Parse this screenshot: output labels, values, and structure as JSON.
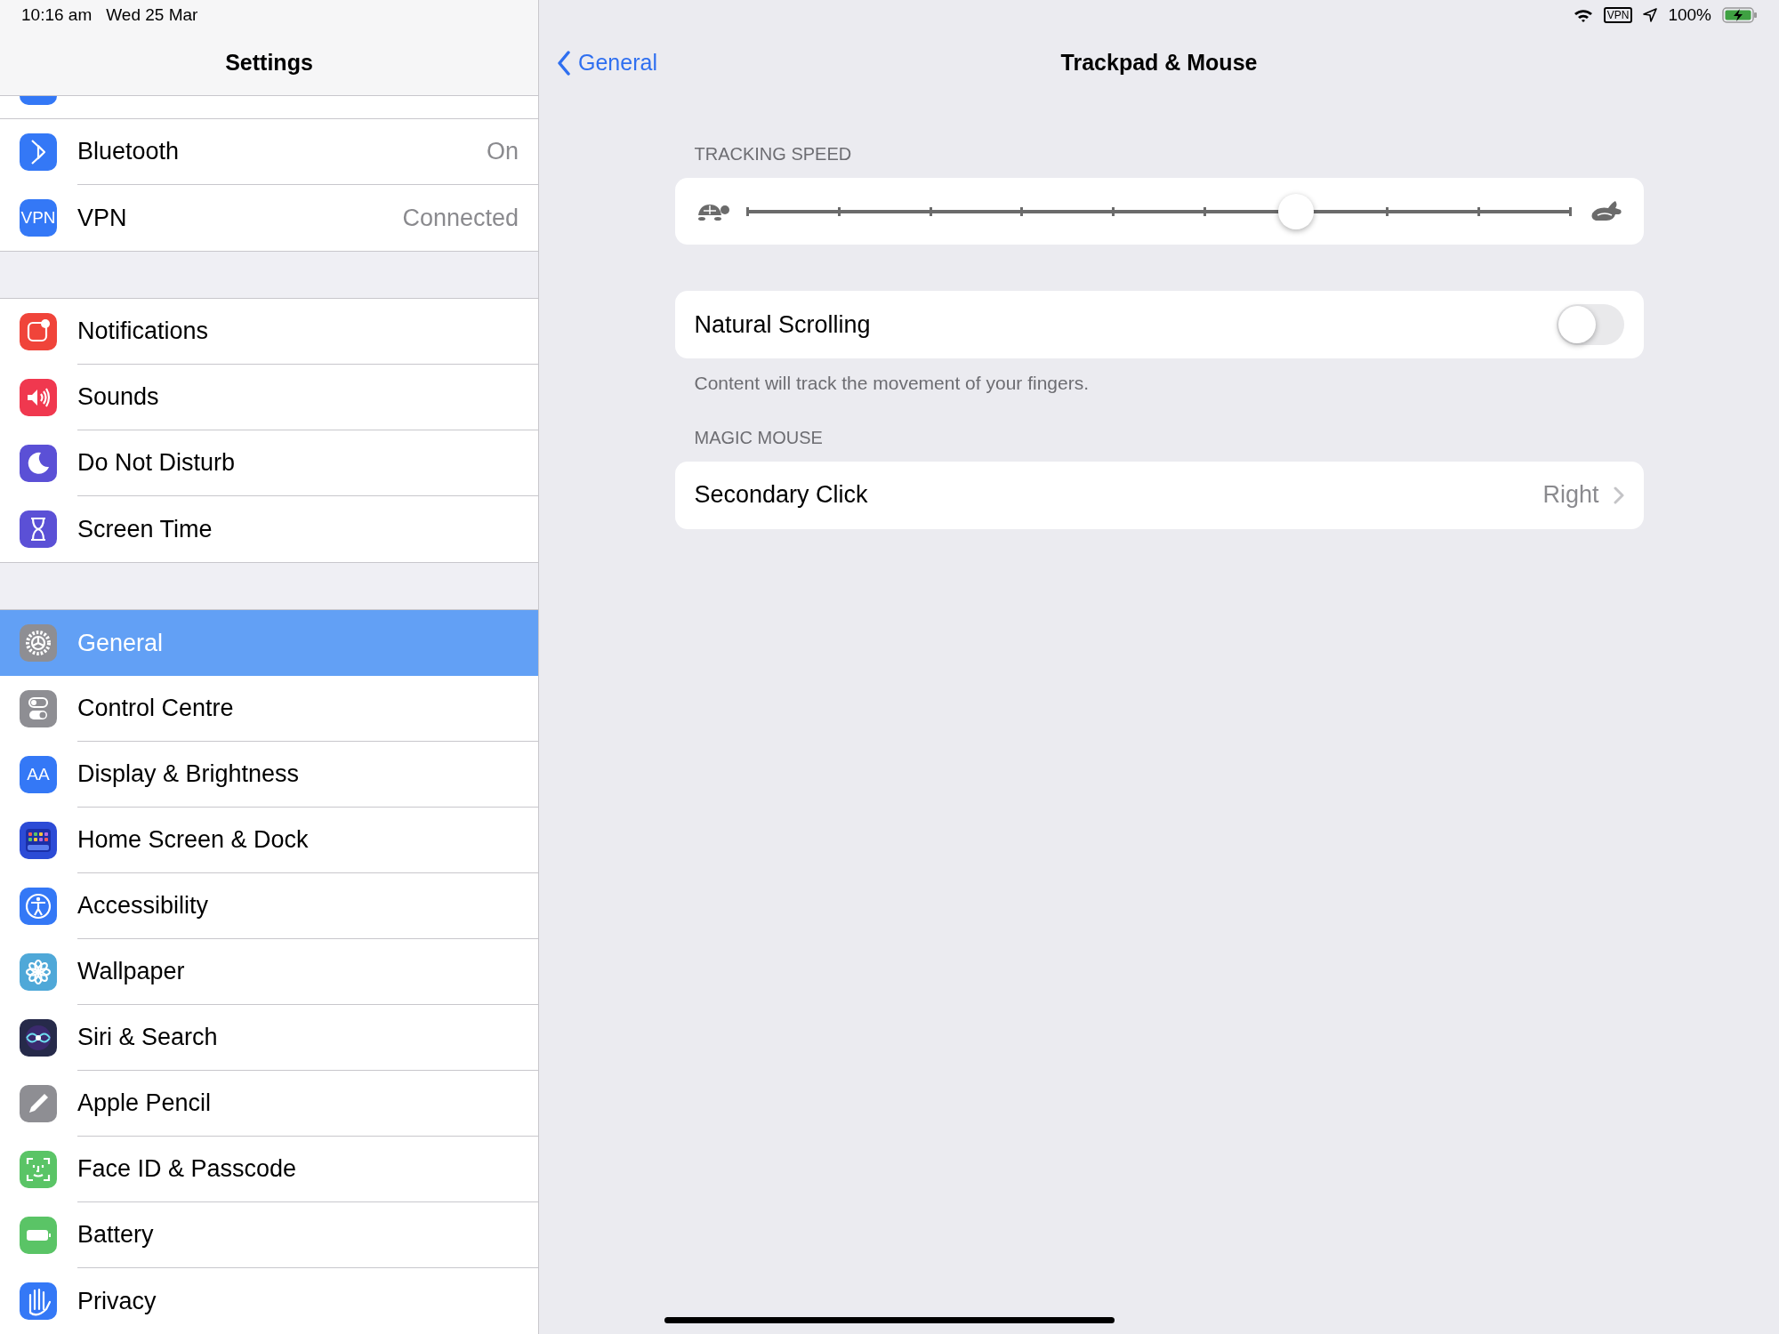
{
  "status_bar": {
    "time": "10:16 am",
    "date": "Wed 25 Mar",
    "vpn": "VPN",
    "battery": "100%"
  },
  "sidebar": {
    "title": "Settings",
    "groups": [
      {
        "items": [
          {
            "label": "Bluetooth",
            "value": "On",
            "selected": false,
            "color": "#3478f6"
          },
          {
            "label": "VPN",
            "value": "Connected",
            "icon_text": "VPN",
            "selected": false,
            "color": "#3478f6"
          }
        ]
      },
      {
        "items": [
          {
            "label": "Notifications",
            "selected": false,
            "color": "#f0443a"
          },
          {
            "label": "Sounds",
            "selected": false,
            "color": "#f0384f"
          },
          {
            "label": "Do Not Disturb",
            "selected": false,
            "color": "#5b50d6"
          },
          {
            "label": "Screen Time",
            "selected": false,
            "color": "#5b50d6"
          }
        ]
      },
      {
        "items": [
          {
            "label": "General",
            "selected": true,
            "color": "#8e8e93"
          },
          {
            "label": "Control Centre",
            "selected": false,
            "color": "#8e8e93"
          },
          {
            "label": "Display & Brightness",
            "icon_text": "AA",
            "selected": false,
            "color": "#3478f6"
          },
          {
            "label": "Home Screen & Dock",
            "selected": false,
            "color": "#2c4bd6"
          },
          {
            "label": "Accessibility",
            "selected": false,
            "color": "#3478f6"
          },
          {
            "label": "Wallpaper",
            "selected": false,
            "color": "#4fa8d8"
          },
          {
            "label": "Siri & Search",
            "selected": false,
            "color": "#262a4a"
          },
          {
            "label": "Apple Pencil",
            "selected": false,
            "color": "#8e8e93"
          },
          {
            "label": "Face ID & Passcode",
            "selected": false,
            "color": "#5ac466"
          },
          {
            "label": "Battery",
            "selected": false,
            "color": "#5ac466"
          },
          {
            "label": "Privacy",
            "selected": false,
            "color": "#3478f6"
          }
        ]
      }
    ]
  },
  "detail": {
    "back": "General",
    "title": "Trackpad & Mouse",
    "tracking_speed": {
      "header": "TRACKING SPEED",
      "level": 0.667
    },
    "natural_scrolling": {
      "label": "Natural Scrolling",
      "on": false,
      "footer": "Content will track the movement of your fingers."
    },
    "magic_mouse": {
      "header": "MAGIC MOUSE",
      "label": "Secondary Click",
      "value": "Right"
    }
  }
}
